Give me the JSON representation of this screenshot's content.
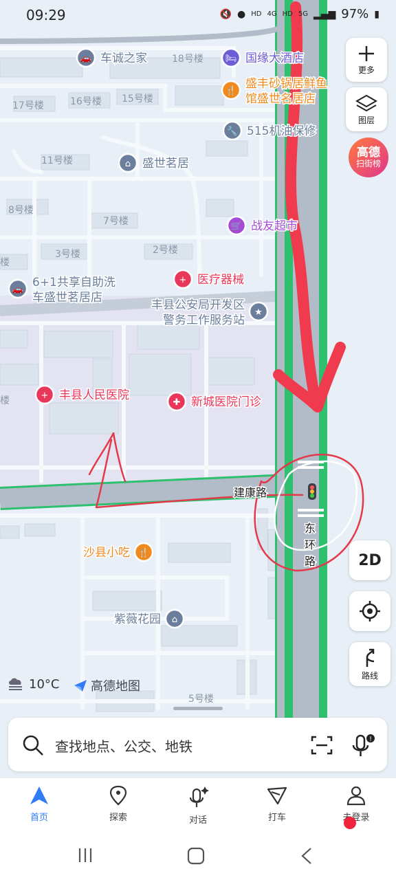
{
  "status_bar": {
    "time": "09:29",
    "hd1": "HD",
    "net1": "4G",
    "hd2": "HD",
    "net2": "5G",
    "battery": "97%"
  },
  "map": {
    "pois": [
      {
        "name": "车诚之家",
        "icon": "car-wash-icon",
        "color": "#6b7f9c"
      },
      {
        "name": "国缘大酒店",
        "icon": "hotel-icon",
        "color": "#6d5cd6"
      },
      {
        "name": "盛丰砂锅居鲜鱼馆盛世名居店",
        "line1": "盛丰砂锅居鲜鱼",
        "line2": "馆盛世名居店",
        "icon": "restaurant-icon",
        "color": "#f08a1c"
      },
      {
        "name": "515机油保修",
        "icon": "car-repair-icon",
        "color": "#6b7f9c"
      },
      {
        "name": "盛世茗居",
        "icon": "residence-icon",
        "color": "#6b7f9c"
      },
      {
        "name": "战友超市",
        "icon": "supermarket-icon",
        "color": "#a64bd6"
      },
      {
        "name": "6+1共享自助洗车盛世茗居店",
        "line1": "6+1共享自助洗",
        "line2": "车盛世茗居店",
        "icon": "car-wash-icon",
        "color": "#6b7f9c"
      },
      {
        "name": "医疗器械",
        "icon": "medical-icon",
        "color": "#e8375a"
      },
      {
        "name": "丰县公安局开发区警务工作服务站",
        "line1": "丰县公安局开发区",
        "line2": "警务工作服务站",
        "icon": "police-icon",
        "color": "#6b7f9c"
      },
      {
        "name": "丰县人民医院",
        "icon": "hospital-icon",
        "color": "#e8375a"
      },
      {
        "name": "新城医院门诊",
        "icon": "clinic-icon",
        "color": "#e8375a"
      },
      {
        "name": "沙县小吃",
        "icon": "restaurant-icon",
        "color": "#f08a1c"
      },
      {
        "name": "紫薇花园",
        "icon": "residence-icon",
        "color": "#6b7f9c"
      }
    ],
    "buildings": [
      "18号楼",
      "17号楼",
      "16号楼",
      "15号楼",
      "11号楼",
      "8号楼",
      "7号楼",
      "3号楼",
      "2号楼",
      "楼",
      "楼",
      "5号楼"
    ],
    "roads": {
      "east": "东环路",
      "south": "建康路"
    }
  },
  "controls": {
    "more_label": "更多",
    "layers_label": "图层",
    "badge_line1": "高德",
    "badge_line2": "扫街榜",
    "mode_2d": "2D",
    "route_label": "路线"
  },
  "weather": {
    "temp": "10°C"
  },
  "brand": {
    "name": "高德地图"
  },
  "search": {
    "placeholder": "查找地点、公交、地铁"
  },
  "tabs": [
    {
      "label": "首页",
      "icon": "home-nav-icon",
      "active": true
    },
    {
      "label": "探索",
      "icon": "explore-pin-icon",
      "active": false
    },
    {
      "label": "对话",
      "icon": "chat-mic-icon",
      "active": false
    },
    {
      "label": "打车",
      "icon": "taxi-icon",
      "active": false
    },
    {
      "label": "未登录",
      "icon": "user-icon",
      "active": false
    }
  ],
  "colors": {
    "accent": "#2f7cf6",
    "road_major": "#b1bcc8",
    "road_border": "#2fc06f",
    "annotation": "#f03b4f"
  }
}
